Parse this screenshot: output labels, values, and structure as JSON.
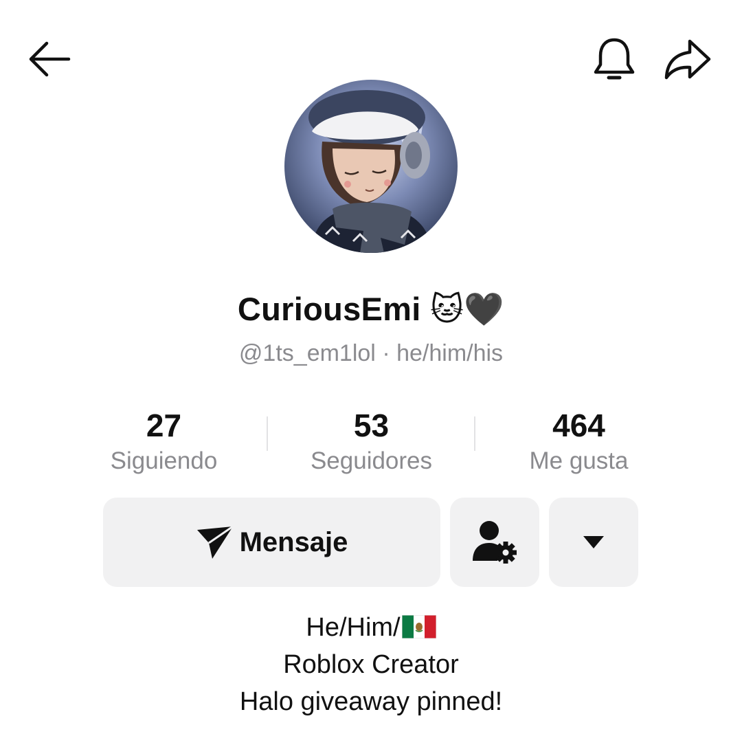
{
  "header": {
    "back_icon": "arrow-left-icon",
    "notifications_icon": "bell-icon",
    "share_icon": "share-arrow-icon"
  },
  "profile": {
    "display_name": "CuriousEmi",
    "name_emojis": "🐱🖤",
    "handle": "@1ts_em1lol",
    "separator": "·",
    "pronouns": "he/him/his"
  },
  "stats": [
    {
      "value": "27",
      "label": "Siguiendo"
    },
    {
      "value": "53",
      "label": "Seguidores"
    },
    {
      "value": "464",
      "label": "Me gusta"
    }
  ],
  "actions": {
    "message_label": "Mensaje",
    "message_icon": "send-icon",
    "friend_settings_icon": "user-settings-icon",
    "more_icon": "caret-down-icon"
  },
  "bio": {
    "line1": "He/Him/",
    "line1_flag": "mexico-flag",
    "line2": "Roblox Creator",
    "line3": "Halo giveaway pinned!"
  },
  "colors": {
    "text": "#111111",
    "muted": "#8a8a8e",
    "button_bg": "#f1f1f2",
    "divider": "#e2e2e4"
  }
}
